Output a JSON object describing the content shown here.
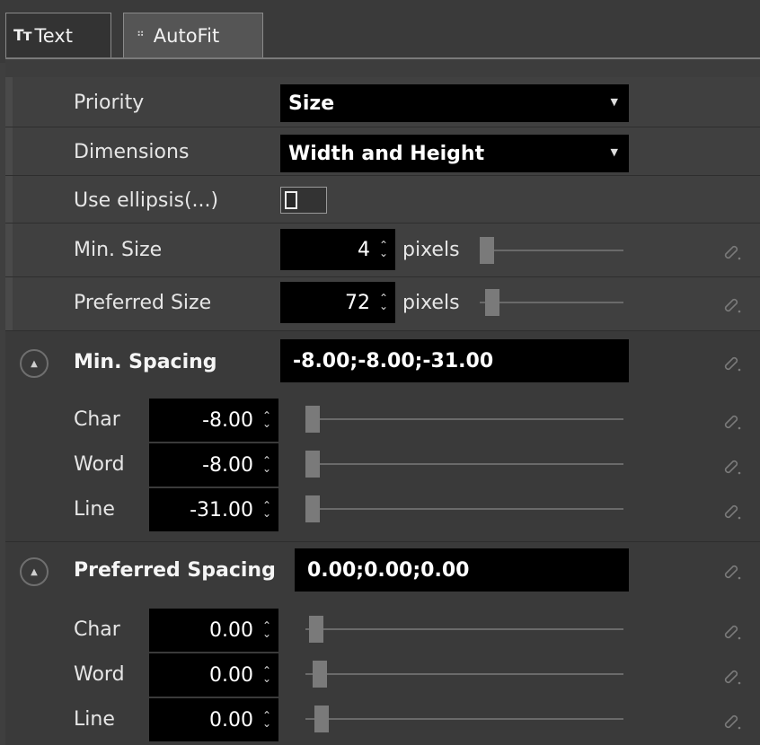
{
  "tabs": [
    {
      "icon": "text-tab-icon",
      "glyph": "Tт",
      "label": "Text"
    },
    {
      "icon": "autofit-tab-icon",
      "glyph": "⠛",
      "label": "AutoFit"
    }
  ],
  "priority": {
    "label": "Priority",
    "value": "Size"
  },
  "dimensions": {
    "label": "Dimensions",
    "value": "Width and Height"
  },
  "ellipsis": {
    "label": "Use ellipsis(...)",
    "checked": false
  },
  "min_size": {
    "label": "Min. Size",
    "value": "4",
    "units": "pixels",
    "slider_fraction": 0.0
  },
  "preferred_size": {
    "label": "Preferred Size",
    "value": "72",
    "units": "pixels",
    "slider_fraction": 0.04
  },
  "min_spacing": {
    "label": "Min. Spacing",
    "value": "-8.00;-8.00;-31.00",
    "rows": [
      {
        "label": "Char",
        "value": "-8.00"
      },
      {
        "label": "Word",
        "value": "-8.00"
      },
      {
        "label": "Line",
        "value": "-31.00"
      }
    ]
  },
  "preferred_spacing": {
    "label": "Preferred Spacing",
    "value": "0.00;0.00;0.00",
    "rows": [
      {
        "label": "Char",
        "value": "0.00"
      },
      {
        "label": "Word",
        "value": "0.00"
      },
      {
        "label": "Line",
        "value": "0.00"
      }
    ]
  },
  "spinner_glyphs": {
    "up": "⌃",
    "down": "⌄"
  },
  "caret_glyph": "▼",
  "collapse_glyph": "▲"
}
